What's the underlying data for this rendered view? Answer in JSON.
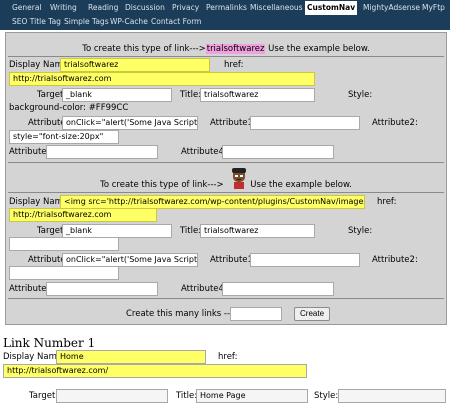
{
  "nav": {
    "row1": [
      "General",
      "Writing",
      "Reading",
      "Discussion",
      "Privacy",
      "Permalinks",
      "Miscellaneous",
      "CustomNav",
      "MightyAdsense",
      "MyFtp"
    ],
    "row2": [
      "SEO Title Tag",
      "Simple Tags",
      "WP-Cache",
      "Contact Form"
    ],
    "active": "CustomNav"
  },
  "example1": {
    "header_pre": "To create this type of link--->",
    "header_link": "trialsoftwarez",
    "header_post": " Use the example below.",
    "display_name_label": "Display Name:",
    "display_name_value": "trialsoftwarez",
    "href_label": "href:",
    "href_value": "http://trialsoftwarez.com",
    "target_label": "Target:",
    "target_value": "_blank",
    "title_label": "Title:",
    "title_value": "trialsoftwarez",
    "style_label": "Style:",
    "style_value": "background-color: #FF99CC",
    "attribute_label": "Attribute:",
    "attribute_value": "onClick=\"alert('Some Java Script!')\"",
    "attribute1_label": "Attribute1:",
    "attribute1_value": "",
    "attribute2_label": "Attribute2:",
    "attribute2_value": "style=\"font-size:20px\"",
    "attribute3_label": "Attribute3:",
    "attribute3_value": "",
    "attribute4_label": "Attribute4:",
    "attribute4_value": ""
  },
  "example2": {
    "header_pre": "To create this type of link--->",
    "header_post": " Use the example below.",
    "display_name_label": "Display Name:",
    "display_name_value": "<img src='http://trialsoftwarez.com/wp-content/plugins/CustomNav/images/bhlcr",
    "href_label": "href:",
    "href_value": "http://trialsoftwarez.com",
    "target_label": "Target:",
    "target_value": "_blank",
    "title_label": "Title:",
    "title_value": "trialsoftwarez",
    "style_label": "Style:",
    "style_value": "",
    "attribute_label": "Attribute:",
    "attribute_value": "onClick=\"alert('Some Java Script!')\"",
    "attribute1_label": "Attribute1:",
    "attribute1_value": "",
    "attribute2_label": "Attribute2:",
    "attribute2_value": "",
    "attribute3_label": "Attribute3:",
    "attribute3_value": "",
    "attribute4_label": "Attribute4:",
    "attribute4_value": ""
  },
  "create": {
    "label": "Create this many links --->",
    "value": "",
    "button": "Create"
  },
  "link1": {
    "heading": "Link Number 1",
    "display_name_label": "Display Name:",
    "display_name_value": "Home",
    "href_label": "href:",
    "href_value": "http://trialsoftwarez.com/",
    "target_label": "Target:",
    "target_value": "",
    "title_label": "Title:",
    "title_value": "Home Page",
    "style_label": "Style:",
    "style_value": ""
  },
  "colors": {
    "nav_bg": "#1c3d59",
    "highlight_yellow": "#ffff66",
    "highlight_pink": "#f0a0e0",
    "panel_gray": "#d4d4d4"
  },
  "icons": {
    "avatar": "bhlcr-avatar-icon"
  }
}
